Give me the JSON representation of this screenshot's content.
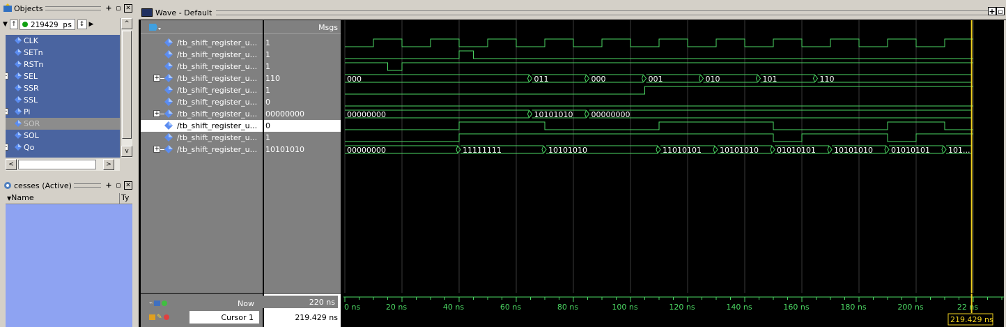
{
  "objects_panel": {
    "title": "Objects",
    "time_value": "219429  ps",
    "items": [
      {
        "name": "CLK",
        "expandable": false,
        "selected": false
      },
      {
        "name": "SETn",
        "expandable": false,
        "selected": false
      },
      {
        "name": "RSTn",
        "expandable": false,
        "selected": false
      },
      {
        "name": "SEL",
        "expandable": true,
        "selected": false
      },
      {
        "name": "SSR",
        "expandable": false,
        "selected": false
      },
      {
        "name": "SSL",
        "expandable": false,
        "selected": false
      },
      {
        "name": "Pi",
        "expandable": true,
        "selected": false
      },
      {
        "name": "SOR",
        "expandable": false,
        "selected": true
      },
      {
        "name": "SOL",
        "expandable": false,
        "selected": false
      },
      {
        "name": "Qo",
        "expandable": true,
        "selected": false
      }
    ]
  },
  "processes_panel": {
    "title": "cesses (Active)",
    "col_name": "Name",
    "col_type": "Ty"
  },
  "wave": {
    "title": "Wave - Default",
    "msgs_header": "Msgs",
    "signals": [
      {
        "name": "/tb_shift_register_u...",
        "value": "1",
        "expandable": false,
        "selected": false
      },
      {
        "name": "/tb_shift_register_u...",
        "value": "1",
        "expandable": false,
        "selected": false
      },
      {
        "name": "/tb_shift_register_u...",
        "value": "1",
        "expandable": false,
        "selected": false
      },
      {
        "name": "/tb_shift_register_u...",
        "value": "110",
        "expandable": true,
        "selected": false
      },
      {
        "name": "/tb_shift_register_u...",
        "value": "1",
        "expandable": false,
        "selected": false
      },
      {
        "name": "/tb_shift_register_u...",
        "value": "0",
        "expandable": false,
        "selected": false
      },
      {
        "name": "/tb_shift_register_u...",
        "value": "00000000",
        "expandable": true,
        "selected": false
      },
      {
        "name": "/tb_shift_register_u...",
        "value": "0",
        "expandable": false,
        "selected": true
      },
      {
        "name": "/tb_shift_register_u...",
        "value": "1",
        "expandable": false,
        "selected": false
      },
      {
        "name": "/tb_shift_register_u...",
        "value": "10101010",
        "expandable": true,
        "selected": false
      }
    ],
    "now_label": "Now",
    "now_value": "220 ns",
    "cursor_label": "Cursor 1",
    "cursor_value": "219.429 ns",
    "cursor_marker_text": "219.429 ns",
    "time_ticks": [
      "0 ns",
      "20 ns",
      "40 ns",
      "60 ns",
      "80 ns",
      "100 ns",
      "120 ns",
      "140 ns",
      "160 ns",
      "180 ns",
      "200 ns",
      "22 ns"
    ],
    "bus_labels": {
      "sel": [
        {
          "t": 0,
          "label": "000"
        },
        {
          "t": 65,
          "label": "011"
        },
        {
          "t": 85,
          "label": "000"
        },
        {
          "t": 105,
          "label": "001"
        },
        {
          "t": 125,
          "label": "010"
        },
        {
          "t": 145,
          "label": "101"
        },
        {
          "t": 165,
          "label": "110"
        }
      ],
      "pi": [
        {
          "t": 0,
          "label": "00000000"
        },
        {
          "t": 65,
          "label": "10101010"
        },
        {
          "t": 85,
          "label": "00000000"
        }
      ],
      "qo": [
        {
          "t": 0,
          "label": "00000000"
        },
        {
          "t": 40,
          "label": "11111111"
        },
        {
          "t": 70,
          "label": "10101010"
        },
        {
          "t": 110,
          "label": "11010101"
        },
        {
          "t": 130,
          "label": "10101010"
        },
        {
          "t": 150,
          "label": "01010101"
        },
        {
          "t": 170,
          "label": "10101010"
        },
        {
          "t": 190,
          "label": "01010101"
        },
        {
          "t": 210,
          "label": "101..."
        }
      ]
    }
  },
  "colors": {
    "wave_green": "#4cd964",
    "cursor_yellow": "#f0d020",
    "grid": "#3a3a3a",
    "list_blue": "#4a64a0",
    "signal_diamond": "#5b8cf0"
  }
}
